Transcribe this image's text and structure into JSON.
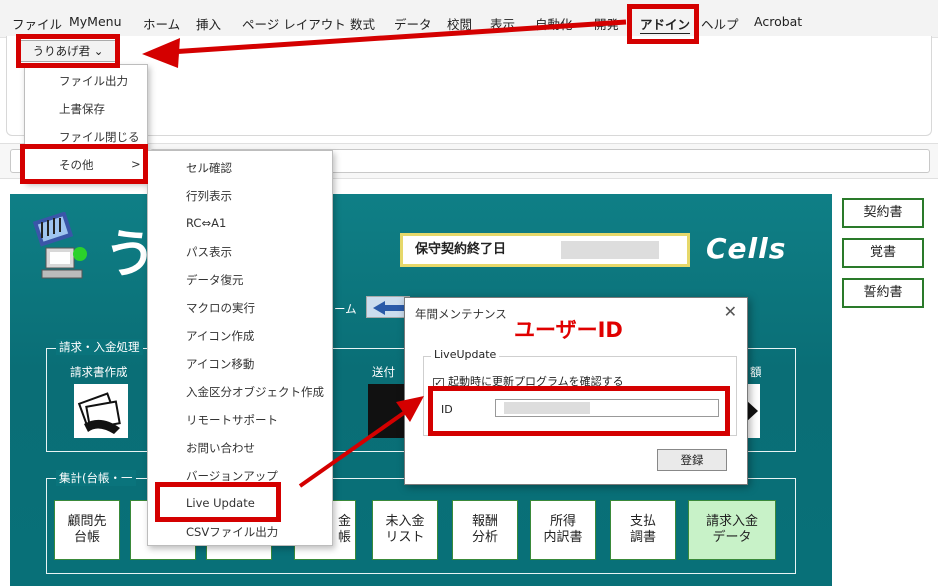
{
  "menubar": {
    "tabs": [
      "ファイル",
      "MyMenu",
      "ホーム",
      "挿入",
      "ページ レイアウト",
      "数式",
      "データ",
      "校閲",
      "表示",
      "自動化",
      "開発",
      "アドイン",
      "ヘルプ",
      "Acrobat"
    ],
    "active_tab": "アドイン"
  },
  "ribbon": {
    "dropdown_label": "うりあげ君 ⌄"
  },
  "menu1": {
    "items": [
      "ファイル出力",
      "上書保存",
      "ファイル閉じる",
      "その他"
    ],
    "submenu_arrow": ">"
  },
  "menu2": {
    "items": [
      "セル確認",
      "行列表示",
      "RC⇔A1",
      "パス表示",
      "データ復元",
      "マクロの実行",
      "アイコン作成",
      "アイコン移動",
      "入金区分オブジェクト作成",
      "リモートサポート",
      "お問い合わせ",
      "バージョンアップ",
      "Live Update",
      "CSVファイル出力"
    ]
  },
  "app": {
    "logo_text": "う",
    "partial_logo": "i",
    "maintenance_label": "保守契約終了日",
    "cells_brand": "Cells",
    "nav_fragment": "ーム",
    "group1_label": "請求・入金処理",
    "group2_label": "集計(台帳・一",
    "tile_labels": {
      "invoice": "請求書作成",
      "send": "送付",
      "amount": "額"
    },
    "tiles": [
      "顧問先\n台帳",
      "",
      "",
      "金\n帳",
      "未入金\nリスト",
      "報酬\n分析",
      "所得\n内訳書",
      "支払\n調書",
      "請求入金\nデータ"
    ]
  },
  "right_buttons": [
    "契約書",
    "覚書",
    "誓約書"
  ],
  "dialog": {
    "title": "年間メンテナンス",
    "close": "✕",
    "group": "LiveUpdate",
    "checkbox_label": "起動時に更新プログラムを確認する",
    "checkbox_mark": "✓",
    "id_label": "ID",
    "register_button": "登録"
  },
  "annotation": {
    "text": "ユーザーID",
    "color": "#d40000"
  },
  "colors": {
    "app_bg": "#0a6e76",
    "highlight": "#d40000",
    "tile_green": "#c8f2c8"
  }
}
